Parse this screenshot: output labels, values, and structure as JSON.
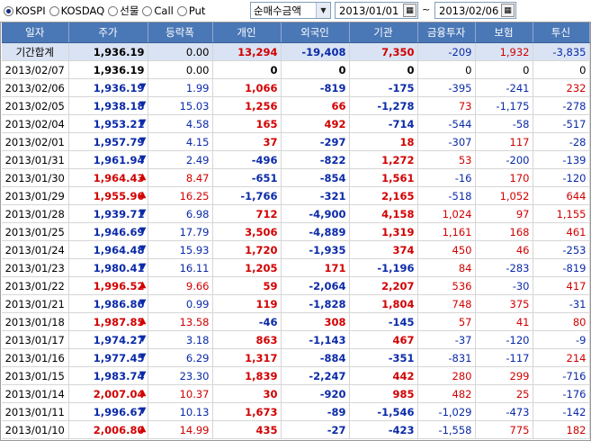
{
  "toolbar": {
    "radios": [
      {
        "label": "KOSPI",
        "checked": true
      },
      {
        "label": "KOSDAQ",
        "checked": false
      },
      {
        "label": "선물",
        "checked": false
      },
      {
        "label": "Call",
        "checked": false
      },
      {
        "label": "Put",
        "checked": false
      }
    ],
    "select_value": "순매수금액",
    "start_date": "2013/01/01",
    "end_date": "2013/02/06",
    "tilde": "~"
  },
  "table": {
    "headers": [
      "일자",
      "주가",
      "등락폭",
      "개인",
      "외국인",
      "기관",
      "금융투자",
      "보험",
      "투신"
    ],
    "total": {
      "date": "기간합계",
      "price": "1,936.19",
      "change": "0.00",
      "indiv": "13,294",
      "foreign": "-19,408",
      "inst": "7,350",
      "fin": "-209",
      "ins": "1,932",
      "trust": "-3,835"
    },
    "rows": [
      {
        "date": "2013/02/07",
        "price": "1,936.19",
        "dir": "",
        "change": "0.00",
        "indiv": "0",
        "foreign": "0",
        "inst": "0",
        "fin": "0",
        "ins": "0",
        "trust": "0"
      },
      {
        "date": "2013/02/06",
        "price": "1,936.19",
        "dir": "down",
        "change": "1.99",
        "indiv": "1,066",
        "foreign": "-819",
        "inst": "-175",
        "fin": "-395",
        "ins": "-241",
        "trust": "232"
      },
      {
        "date": "2013/02/05",
        "price": "1,938.18",
        "dir": "down",
        "change": "15.03",
        "indiv": "1,256",
        "foreign": "66",
        "inst": "-1,278",
        "fin": "73",
        "ins": "-1,175",
        "trust": "-278"
      },
      {
        "date": "2013/02/04",
        "price": "1,953.21",
        "dir": "down",
        "change": "4.58",
        "indiv": "165",
        "foreign": "492",
        "inst": "-714",
        "fin": "-544",
        "ins": "-58",
        "trust": "-517"
      },
      {
        "date": "2013/02/01",
        "price": "1,957.79",
        "dir": "down",
        "change": "4.15",
        "indiv": "37",
        "foreign": "-297",
        "inst": "18",
        "fin": "-307",
        "ins": "117",
        "trust": "-28"
      },
      {
        "date": "2013/01/31",
        "price": "1,961.94",
        "dir": "down",
        "change": "2.49",
        "indiv": "-496",
        "foreign": "-822",
        "inst": "1,272",
        "fin": "53",
        "ins": "-200",
        "trust": "-139"
      },
      {
        "date": "2013/01/30",
        "price": "1,964.43",
        "dir": "up",
        "change": "8.47",
        "indiv": "-651",
        "foreign": "-854",
        "inst": "1,561",
        "fin": "-16",
        "ins": "170",
        "trust": "-120"
      },
      {
        "date": "2013/01/29",
        "price": "1,955.96",
        "dir": "up",
        "change": "16.25",
        "indiv": "-1,766",
        "foreign": "-321",
        "inst": "2,165",
        "fin": "-518",
        "ins": "1,052",
        "trust": "644"
      },
      {
        "date": "2013/01/28",
        "price": "1,939.71",
        "dir": "down",
        "change": "6.98",
        "indiv": "712",
        "foreign": "-4,900",
        "inst": "4,158",
        "fin": "1,024",
        "ins": "97",
        "trust": "1,155"
      },
      {
        "date": "2013/01/25",
        "price": "1,946.69",
        "dir": "down",
        "change": "17.79",
        "indiv": "3,506",
        "foreign": "-4,889",
        "inst": "1,319",
        "fin": "1,161",
        "ins": "168",
        "trust": "461"
      },
      {
        "date": "2013/01/24",
        "price": "1,964.48",
        "dir": "down",
        "change": "15.93",
        "indiv": "1,720",
        "foreign": "-1,935",
        "inst": "374",
        "fin": "450",
        "ins": "46",
        "trust": "-253"
      },
      {
        "date": "2013/01/23",
        "price": "1,980.41",
        "dir": "down",
        "change": "16.11",
        "indiv": "1,205",
        "foreign": "171",
        "inst": "-1,196",
        "fin": "84",
        "ins": "-283",
        "trust": "-819"
      },
      {
        "date": "2013/01/22",
        "price": "1,996.52",
        "dir": "up",
        "change": "9.66",
        "indiv": "59",
        "foreign": "-2,064",
        "inst": "2,207",
        "fin": "536",
        "ins": "-30",
        "trust": "417"
      },
      {
        "date": "2013/01/21",
        "price": "1,986.86",
        "dir": "down",
        "change": "0.99",
        "indiv": "119",
        "foreign": "-1,828",
        "inst": "1,804",
        "fin": "748",
        "ins": "375",
        "trust": "-31"
      },
      {
        "date": "2013/01/18",
        "price": "1,987.85",
        "dir": "up",
        "change": "13.58",
        "indiv": "-46",
        "foreign": "308",
        "inst": "-145",
        "fin": "57",
        "ins": "41",
        "trust": "80"
      },
      {
        "date": "2013/01/17",
        "price": "1,974.27",
        "dir": "down",
        "change": "3.18",
        "indiv": "863",
        "foreign": "-1,143",
        "inst": "467",
        "fin": "-37",
        "ins": "-120",
        "trust": "-9"
      },
      {
        "date": "2013/01/16",
        "price": "1,977.45",
        "dir": "down",
        "change": "6.29",
        "indiv": "1,317",
        "foreign": "-884",
        "inst": "-351",
        "fin": "-831",
        "ins": "-117",
        "trust": "214"
      },
      {
        "date": "2013/01/15",
        "price": "1,983.74",
        "dir": "down",
        "change": "23.30",
        "indiv": "1,839",
        "foreign": "-2,247",
        "inst": "442",
        "fin": "280",
        "ins": "299",
        "trust": "-716"
      },
      {
        "date": "2013/01/14",
        "price": "2,007.04",
        "dir": "up",
        "change": "10.37",
        "indiv": "30",
        "foreign": "-920",
        "inst": "985",
        "fin": "482",
        "ins": "25",
        "trust": "-176"
      },
      {
        "date": "2013/01/11",
        "price": "1,996.67",
        "dir": "down",
        "change": "10.13",
        "indiv": "1,673",
        "foreign": "-89",
        "inst": "-1,546",
        "fin": "-1,029",
        "ins": "-473",
        "trust": "-142"
      },
      {
        "date": "2013/01/10",
        "price": "2,006.80",
        "dir": "up",
        "change": "14.99",
        "indiv": "435",
        "foreign": "-27",
        "inst": "-423",
        "fin": "-1,558",
        "ins": "775",
        "trust": "182"
      }
    ]
  },
  "colors": {
    "header_bg": "#4a77b6",
    "total_bg": "#d9e3f3",
    "up": "#d20000",
    "down": "#0a2aa8"
  },
  "icons": {
    "up": "triangle-up-icon",
    "down": "triangle-down-icon",
    "calendar": "calendar-icon",
    "dropdown": "chevron-down-icon"
  }
}
